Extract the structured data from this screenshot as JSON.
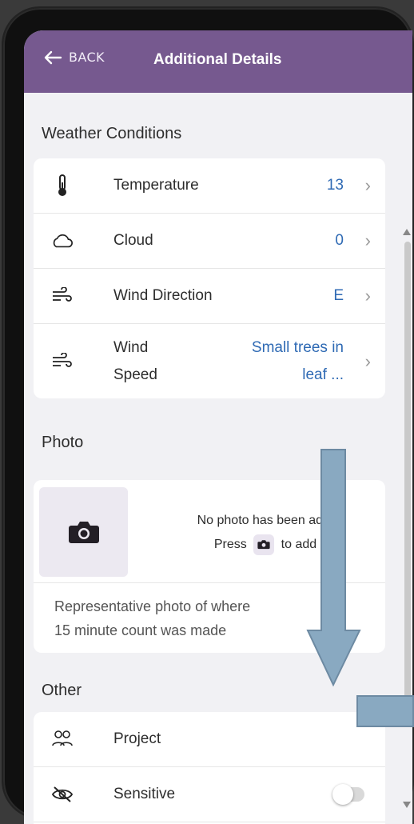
{
  "header": {
    "back_label": "BACK",
    "title": "Additional Details"
  },
  "sections": {
    "weather_title": "Weather Conditions",
    "photo_title": "Photo",
    "other_title": "Other"
  },
  "weather": {
    "temperature": {
      "label": "Temperature",
      "value": "13"
    },
    "cloud": {
      "label": "Cloud",
      "value": "0"
    },
    "wind_direction": {
      "label": "Wind Direction",
      "value": "E"
    },
    "wind_speed": {
      "label_line1": "Wind",
      "label_line2": "Speed",
      "value_line1": "Small trees in",
      "value_line2": "leaf ..."
    }
  },
  "photo": {
    "message_line1": "No photo has been ad",
    "message_line1_end": "d.",
    "message_press": "Press",
    "message_to_add": "to add",
    "description_line1": "Representative photo of where",
    "description_line2": "15 minute count was made"
  },
  "other": {
    "project_label": "Project",
    "sensitive_label": "Sensitive"
  },
  "colors": {
    "appbar": "#76598f",
    "value_blue": "#2f6ab4",
    "overlay": "#89a9c1"
  }
}
